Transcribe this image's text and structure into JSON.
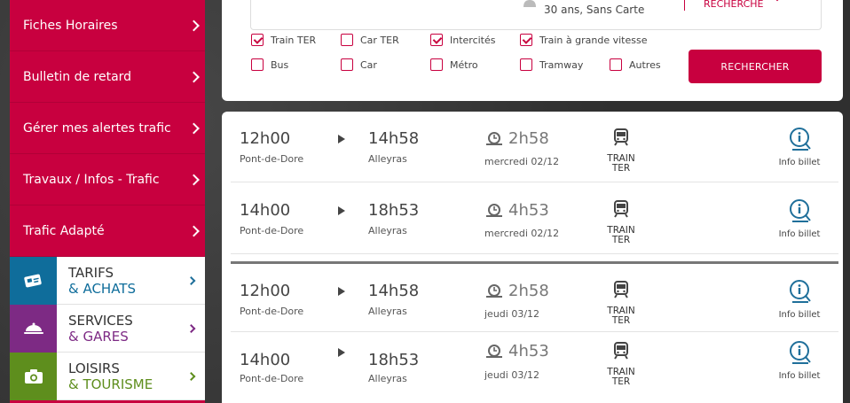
{
  "sidebar": {
    "menu": [
      {
        "label": "Fiches Horaires"
      },
      {
        "label": "Bulletin de retard"
      },
      {
        "label": "Gérer mes alertes trafic"
      },
      {
        "label": "Travaux / Infos - Trafic"
      },
      {
        "label": "Trafic Adapté"
      }
    ],
    "categories": [
      {
        "line1": "TARIFS",
        "line2": "& ACHATS",
        "icon": "card-icon"
      },
      {
        "line1": "SERVICES",
        "line2": "& GARES",
        "icon": "service-icon"
      },
      {
        "line1": "LOISIRS",
        "line2": "& TOURISME",
        "icon": "camera-icon"
      }
    ]
  },
  "search": {
    "passenger": "30 ans, Sans Carte",
    "recherche_label": "RECHERCHE",
    "transports": [
      {
        "label": "Train TER",
        "checked": true
      },
      {
        "label": "Car TER",
        "checked": false
      },
      {
        "label": "Intercités",
        "checked": true
      },
      {
        "label": "Train à grande vitesse",
        "checked": true
      },
      {
        "label": "Bus",
        "checked": false
      },
      {
        "label": "Car",
        "checked": false
      },
      {
        "label": "Métro",
        "checked": false
      },
      {
        "label": "Tramway",
        "checked": false
      },
      {
        "label": "Autres",
        "checked": false
      }
    ],
    "button_label": "RECHERCHER"
  },
  "results": [
    {
      "dep_time": "12h00",
      "dep_station": "Pont-de-Dore",
      "arr_time": "14h58",
      "arr_station": "Alleyras",
      "duration": "2h58",
      "date": "mercredi 02/12",
      "mode_line1": "TRAIN",
      "mode_line2": "TER",
      "info_label": "Info billet"
    },
    {
      "dep_time": "14h00",
      "dep_station": "Pont-de-Dore",
      "arr_time": "18h53",
      "arr_station": "Alleyras",
      "duration": "4h53",
      "date": "mercredi 02/12",
      "mode_line1": "TRAIN",
      "mode_line2": "TER",
      "info_label": "Info billet"
    },
    {
      "dep_time": "12h00",
      "dep_station": "Pont-de-Dore",
      "arr_time": "14h58",
      "arr_station": "Alleyras",
      "duration": "2h58",
      "date": "jeudi 03/12",
      "mode_line1": "TRAIN",
      "mode_line2": "TER",
      "info_label": "Info billet"
    },
    {
      "dep_time": "14h00",
      "dep_station": "Pont-de-Dore",
      "arr_time": "18h53",
      "arr_station": "Alleyras",
      "duration": "4h53",
      "date": "jeudi 03/12",
      "mode_line1": "TRAIN",
      "mode_line2": "TER",
      "info_label": "Info billet"
    }
  ],
  "colors": {
    "brand": "#c8003f",
    "tarifs": "#0f6d9b",
    "services": "#7d2a84",
    "loisirs": "#5e8e1d",
    "info": "#1f6f9a"
  }
}
